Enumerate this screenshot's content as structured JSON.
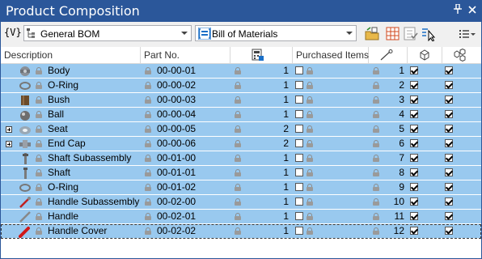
{
  "window": {
    "title": "Product Composition"
  },
  "toolbar": {
    "variables_label": "{V}",
    "bom_type": "General BOM",
    "bom_view": "Bill of Materials"
  },
  "columns": {
    "description": "Description",
    "part_no": "Part No.",
    "purchased": "Purchased Items"
  },
  "rows": [
    {
      "description": "Body",
      "part_no": "00-00-01",
      "qty": "1",
      "item": "1",
      "icon": "cast-body-icon",
      "expandable": false,
      "indent": 0
    },
    {
      "description": "O-Ring",
      "part_no": "00-00-02",
      "qty": "1",
      "item": "2",
      "icon": "o-ring-icon",
      "expandable": false,
      "indent": 0
    },
    {
      "description": "Bush",
      "part_no": "00-00-03",
      "qty": "1",
      "item": "3",
      "icon": "bush-icon",
      "expandable": false,
      "indent": 0
    },
    {
      "description": "Ball",
      "part_no": "00-00-04",
      "qty": "1",
      "item": "4",
      "icon": "ball-icon",
      "expandable": false,
      "indent": 0
    },
    {
      "description": "Seat",
      "part_no": "00-00-05",
      "qty": "2",
      "item": "5",
      "icon": "seat-icon",
      "expandable": true,
      "indent": 0
    },
    {
      "description": "End Cap",
      "part_no": "00-00-06",
      "qty": "2",
      "item": "6",
      "icon": "end-cap-icon",
      "expandable": true,
      "indent": 0
    },
    {
      "description": "Shaft Subassembly",
      "part_no": "00-01-00",
      "qty": "1",
      "item": "7",
      "icon": "shaft-subassembly-icon",
      "expandable": false,
      "indent": 0
    },
    {
      "description": "Shaft",
      "part_no": "00-01-01",
      "qty": "1",
      "item": "8",
      "icon": "shaft-icon",
      "expandable": false,
      "indent": 0
    },
    {
      "description": "O-Ring",
      "part_no": "00-01-02",
      "qty": "1",
      "item": "9",
      "icon": "o-ring-icon",
      "expandable": false,
      "indent": 0
    },
    {
      "description": "Handle Subassembly",
      "part_no": "00-02-00",
      "qty": "1",
      "item": "10",
      "icon": "handle-subassembly-icon",
      "expandable": false,
      "indent": 0
    },
    {
      "description": "Handle",
      "part_no": "00-02-01",
      "qty": "1",
      "item": "11",
      "icon": "handle-icon",
      "expandable": false,
      "indent": 0
    },
    {
      "description": "Handle Cover",
      "part_no": "00-02-02",
      "qty": "1",
      "item": "12",
      "icon": "handle-cover-icon",
      "expandable": false,
      "indent": 0
    }
  ],
  "colors": {
    "titlebar": "#2b579a",
    "row_selected": "#99c9ef"
  }
}
